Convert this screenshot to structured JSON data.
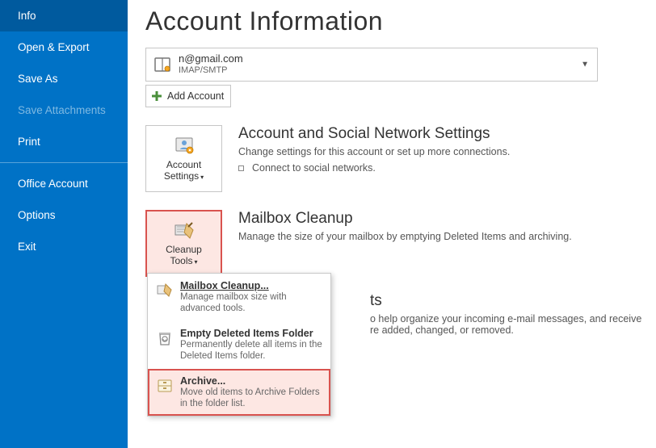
{
  "sidebar": {
    "items": [
      {
        "label": "Info",
        "state": "selected"
      },
      {
        "label": "Open & Export",
        "state": ""
      },
      {
        "label": "Save As",
        "state": ""
      },
      {
        "label": "Save Attachments",
        "state": "disabled"
      },
      {
        "label": "Print",
        "state": ""
      }
    ],
    "bottom_items": [
      {
        "label": "Office Account"
      },
      {
        "label": "Options"
      },
      {
        "label": "Exit"
      }
    ]
  },
  "page": {
    "title": "Account Information"
  },
  "account_dropdown": {
    "email_masked": "n@gmail.com",
    "protocol": "IMAP/SMTP"
  },
  "add_account_btn": {
    "label": "Add Account"
  },
  "sections": {
    "acct_settings": {
      "btn_line1": "Account",
      "btn_line2": "Settings",
      "title": "Account and Social Network Settings",
      "desc": "Change settings for this account or set up more connections.",
      "bullet": "Connect to social networks."
    },
    "cleanup": {
      "btn_line1": "Cleanup",
      "btn_line2": "Tools",
      "title": "Mailbox Cleanup",
      "desc": "Manage the size of your mailbox by emptying Deleted Items and archiving."
    },
    "rules": {
      "title_fragment": "ts",
      "desc_line1": "o help organize your incoming e-mail messages, and receive",
      "desc_line2": "re added, changed, or removed."
    }
  },
  "menu": {
    "items": [
      {
        "title": "Mailbox Cleanup...",
        "desc": "Manage mailbox size with advanced tools."
      },
      {
        "title": "Empty Deleted Items Folder",
        "desc": "Permanently delete all items in the Deleted Items folder."
      },
      {
        "title": "Archive...",
        "desc": "Move old items to Archive Folders in the folder list."
      }
    ]
  }
}
